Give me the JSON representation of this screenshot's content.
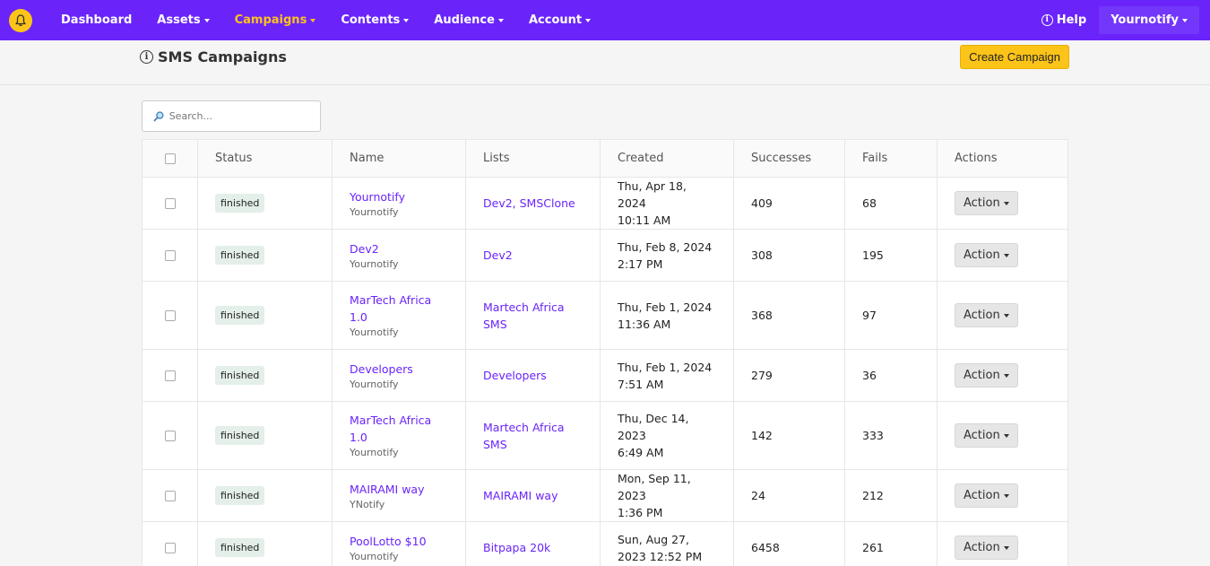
{
  "nav": {
    "items": [
      {
        "label": "Dashboard",
        "dropdown": false,
        "active": false
      },
      {
        "label": "Assets",
        "dropdown": true,
        "active": false
      },
      {
        "label": "Campaigns",
        "dropdown": true,
        "active": true
      },
      {
        "label": "Contents",
        "dropdown": true,
        "active": false
      },
      {
        "label": "Audience",
        "dropdown": true,
        "active": false
      },
      {
        "label": "Account",
        "dropdown": true,
        "active": false
      }
    ],
    "help_label": "Help",
    "user_label": "Yournotify"
  },
  "colors": {
    "brand": "#6a24fa",
    "accent": "#fcc419",
    "active_nav": "#ffc21b"
  },
  "page": {
    "title": "SMS Campaigns",
    "create_label": "Create Campaign",
    "search_placeholder": "Search..."
  },
  "table": {
    "columns": [
      "Status",
      "Name",
      "Lists",
      "Created",
      "Successes",
      "Fails",
      "Actions"
    ],
    "action_label": "Action",
    "rows": [
      {
        "status": "finished",
        "name": "Yournotify",
        "owner": "Yournotify",
        "lists": "Dev2, SMSClone",
        "created_1": "Thu, Apr 18, 2024",
        "created_2": "10:11 AM",
        "successes": "409",
        "fails": "68"
      },
      {
        "status": "finished",
        "name": "Dev2",
        "owner": "Yournotify",
        "lists": "Dev2",
        "created_1": "Thu, Feb 8, 2024",
        "created_2": "2:17 PM",
        "successes": "308",
        "fails": "195"
      },
      {
        "status": "finished",
        "name": "MarTech Africa 1.0",
        "owner": "Yournotify",
        "lists": "Martech Africa SMS",
        "created_1": "Thu, Feb 1, 2024",
        "created_2": "11:36 AM",
        "successes": "368",
        "fails": "97"
      },
      {
        "status": "finished",
        "name": "Developers",
        "owner": "Yournotify",
        "lists": "Developers",
        "created_1": "Thu, Feb 1, 2024",
        "created_2": "7:51 AM",
        "successes": "279",
        "fails": "36"
      },
      {
        "status": "finished",
        "name": "MarTech Africa 1.0",
        "owner": "Yournotify",
        "lists": "Martech Africa SMS",
        "created_1": "Thu, Dec 14, 2023",
        "created_2": "6:49 AM",
        "successes": "142",
        "fails": "333"
      },
      {
        "status": "finished",
        "name": "MAIRAMI way",
        "owner": "YNotify",
        "lists": "MAIRAMI way",
        "created_1": "Mon, Sep 11, 2023",
        "created_2": "1:36 PM",
        "successes": "24",
        "fails": "212"
      },
      {
        "status": "finished",
        "name": "PoolLotto $10",
        "owner": "Yournotify",
        "lists": "Bitpapa 20k",
        "created_1": "Sun, Aug 27,",
        "created_2": "2023 12:52 PM",
        "successes": "6458",
        "fails": "261"
      }
    ]
  }
}
